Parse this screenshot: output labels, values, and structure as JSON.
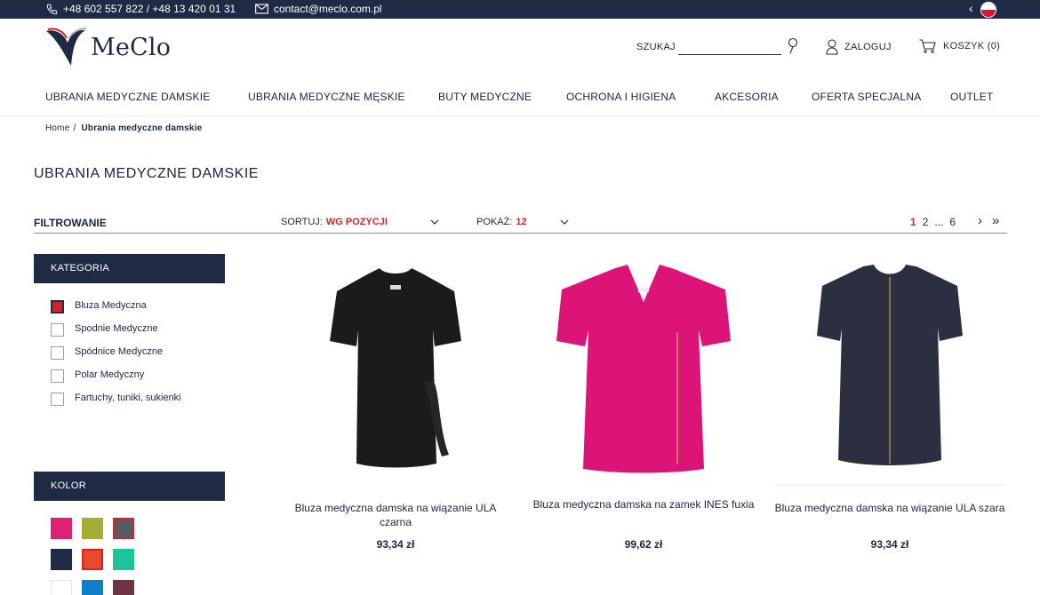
{
  "topbar": {
    "phone": "+48 602 557 822 / +48 13 420 01 31",
    "email": "contact@meclo.com.pl",
    "flag_colors": [
      "#ffffff",
      "#dc143c"
    ]
  },
  "header": {
    "logo_text": "MeClo",
    "search_label": "SZUKAJ",
    "search_value": "",
    "login_label": "ZALOGUJ",
    "cart_label": "KOSZYK (0)"
  },
  "nav": {
    "items": [
      "UBRANIA MEDYCZNE DAMSKIE",
      "UBRANIA MEDYCZNE MĘSKIE",
      "BUTY MEDYCZNE",
      "OCHRONA I HIGIENA",
      "AKCESORIA",
      "OFERTA SPECJALNA",
      "OUTLET"
    ]
  },
  "breadcrumb": {
    "home": "Home",
    "separator": "/",
    "current": "Ubrania medyczne damskie"
  },
  "page_title": "UBRANIA MEDYCZNE DAMSKIE",
  "toolbar": {
    "filter_title": "FILTROWANIE",
    "sort_label": "SORTUJ:",
    "sort_value": "WG POZYCJI",
    "show_label": "POKAŻ:",
    "show_value": "12",
    "pages": [
      "1",
      "2",
      "...",
      "6"
    ],
    "active_page": "1",
    "next": "›",
    "last": "»"
  },
  "sidebar": {
    "category_title": "KATEGORIA",
    "categories": [
      {
        "label": "Bluza Medyczna",
        "checked": true
      },
      {
        "label": "Spodnie Medyczne",
        "checked": false
      },
      {
        "label": "Spódnice Medyczne",
        "checked": false
      },
      {
        "label": "Polar Medyczny",
        "checked": false
      },
      {
        "label": "Fartuchy, tuniki, sukienki",
        "checked": false
      }
    ],
    "color_title": "KOLOR",
    "colors": [
      {
        "hex": "#dd2175",
        "selected": false
      },
      {
        "hex": "#a5ad34",
        "selected": false
      },
      {
        "hex": "#585b60",
        "selected": true
      },
      {
        "hex": "#1f2a44",
        "selected": false
      },
      {
        "hex": "#e84a2c",
        "selected": true
      },
      {
        "hex": "#1cc49c",
        "selected": false
      },
      {
        "hex": "#ffffff",
        "selected": false
      },
      {
        "hex": "#0f80c8",
        "selected": false
      },
      {
        "hex": "#6e3443",
        "selected": false
      }
    ]
  },
  "products": [
    {
      "name": "Bluza medyczna damska na wiązanie ULA czarna",
      "price": "93,34 zł",
      "color": "#1b1b1b"
    },
    {
      "name": "Bluza medyczna damska na zamek INES fuxia",
      "price": "99,62 zł",
      "color": "#dc1477"
    },
    {
      "name": "Bluza medyczna damska na wiązanie ULA szara",
      "price": "93,34 zł",
      "color": "#2b2f3f"
    }
  ],
  "colors": {
    "navy": "#1f2a44",
    "accent_red": "#d2232a"
  }
}
